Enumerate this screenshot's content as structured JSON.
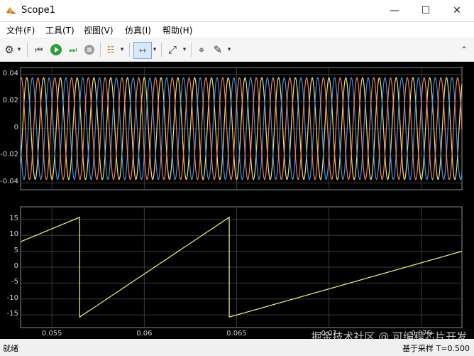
{
  "window": {
    "title": "Scope1",
    "minimize": "—",
    "maximize": "☐",
    "close": "✕"
  },
  "menu": [
    "文件(F)",
    "工具(T)",
    "视图(V)",
    "仿真(I)",
    "帮助(H)"
  ],
  "toolbar": {
    "settings": "⚙",
    "rewind": "⏮",
    "run": "▶",
    "step": "⏭",
    "stop": "■",
    "layout": "☷",
    "zoom_x": "⇿",
    "fit": "⤢",
    "cursor": "⌖",
    "pen": "✎",
    "arrow": "▾",
    "expand": "⌃"
  },
  "colors": {
    "phase_a": "#f0e07a",
    "phase_b": "#4a8fe0",
    "phase_c": "#f0805a",
    "sawtooth": "#f5f08a",
    "axis": "#cfcfcf",
    "grid": "#3a3a3a"
  },
  "chart_data": [
    {
      "type": "line",
      "title": "",
      "xlabel": "",
      "ylabel": "",
      "xlim": [
        0.0533,
        0.0772
      ],
      "ylim": [
        -0.045,
        0.045
      ],
      "yticks": [
        "0.04",
        "0.02",
        "0",
        "-0.02",
        "-0.04"
      ],
      "ytick_values": [
        0.04,
        0.02,
        0,
        -0.02,
        -0.04
      ],
      "xticks": [
        "0.055",
        "0.06",
        "0.065",
        "0.07",
        "0.075"
      ],
      "xtick_values": [
        0.055,
        0.06,
        0.065,
        0.07,
        0.075
      ],
      "grid": true,
      "series": [
        {
          "amplitude": 0.0375,
          "frequency_hz": 1100,
          "phase_deg": 90,
          "color": "#f0e07a"
        },
        {
          "amplitude": 0.0375,
          "frequency_hz": 1100,
          "phase_deg": -30,
          "color": "#4a8fe0"
        },
        {
          "amplitude": 0.0375,
          "frequency_hz": 1100,
          "phase_deg": 210,
          "color": "#f0805a"
        }
      ]
    },
    {
      "type": "line",
      "title": "",
      "xlabel": "",
      "ylabel": "",
      "xlim": [
        0.0533,
        0.0772
      ],
      "ylim": [
        -19,
        19
      ],
      "yticks": [
        "15",
        "10",
        "5",
        "0",
        "-5",
        "-10",
        "-15"
      ],
      "ytick_values": [
        15,
        10,
        5,
        0,
        -5,
        -10,
        -15
      ],
      "xticks": [
        "0.055",
        "0.06",
        "0.065",
        "0.07",
        "0.075"
      ],
      "xtick_values": [
        0.055,
        0.06,
        0.065,
        0.07,
        0.075
      ],
      "grid": true,
      "series": [
        {
          "points": [
            [
              0.0533,
              8.0
            ],
            [
              0.0565,
              15.7
            ],
            [
              0.0565,
              -15.7
            ],
            [
              0.0646,
              15.7
            ],
            [
              0.0646,
              -15.7
            ],
            [
              0.0772,
              5.0
            ]
          ],
          "color": "#f5f08a"
        }
      ]
    }
  ],
  "status": {
    "left": "就绪",
    "right": "基于采样  T=0.500"
  },
  "watermark": "掘金技术社区 @ 可编程芯片开发"
}
